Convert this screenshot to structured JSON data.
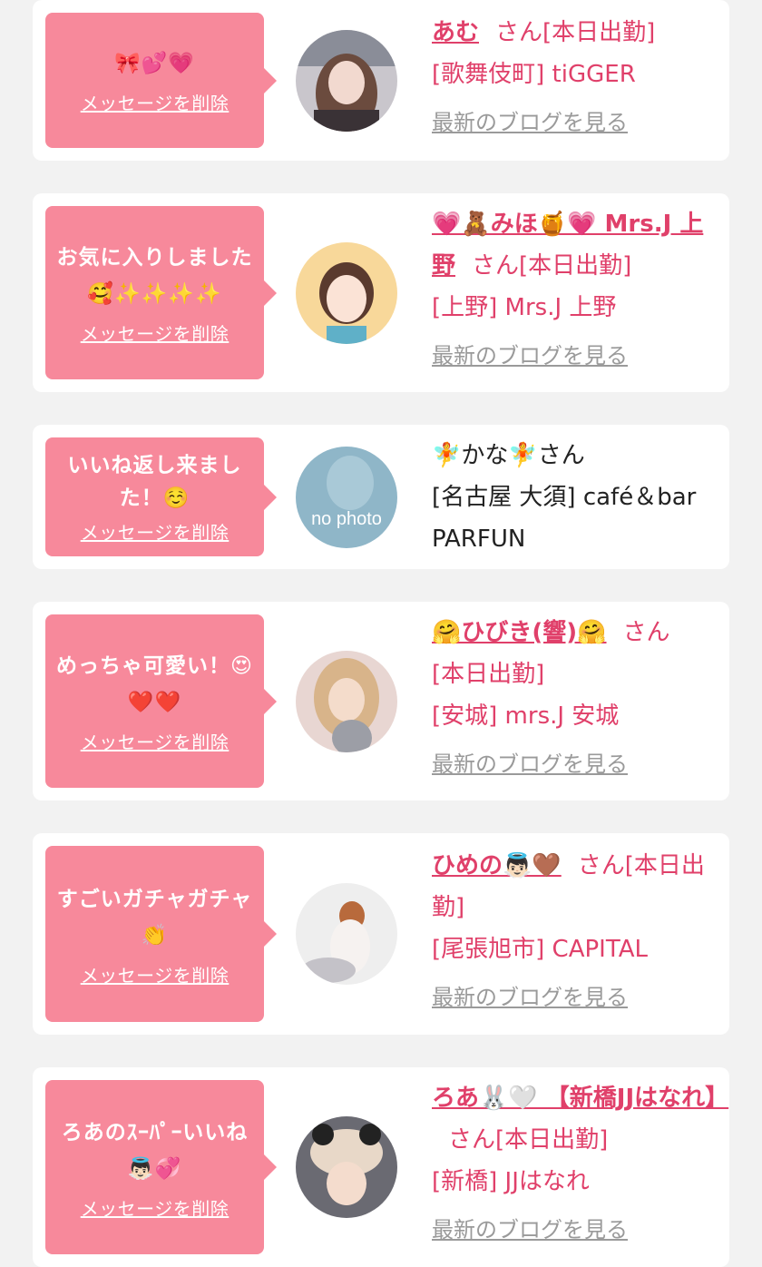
{
  "delete_label": "メッセージを削除",
  "blog_label": "最新のブログを見る",
  "colors": {
    "bubble": "#f7899b",
    "accent": "#e0406a",
    "muted": "#9a9a9a",
    "background": "#f2f2f2"
  },
  "items": [
    {
      "message": "🎀💕💗",
      "name": "あむ",
      "honorific": "さん",
      "status": "[本日出勤]",
      "shop": "[歌舞伎町] tiGGER",
      "has_blog": true,
      "avatar": "avatar-photo"
    },
    {
      "message": "お気に入りしました🥰✨✨✨✨",
      "name": "💗🧸みほ🍯💗 Mrs.J 上野",
      "honorific": "さん",
      "status": "[本日出勤]",
      "shop": "[上野] Mrs.J 上野",
      "has_blog": true,
      "avatar": "avatar-illustration"
    },
    {
      "message": "いいね返し来ました！☺️",
      "name": "🧚かな🧚",
      "honorific": "さん",
      "status": "",
      "shop": "[名古屋 大須] café＆bar PARFUN",
      "has_blog": false,
      "avatar": "no-photo",
      "avatar_text": "no photo"
    },
    {
      "message": "めっちゃ可愛い！😍❤️❤️",
      "name": "🤗ひびき(響)🤗",
      "honorific": "さん",
      "status": "[本日出勤]",
      "shop": "[安城] mrs.J 安城",
      "has_blog": true,
      "avatar": "avatar-photo"
    },
    {
      "message": "すごいガチャガチャ👏",
      "name": "ひめの👼🏻🤎",
      "honorific": "さん",
      "status": "[本日出勤]",
      "shop": "[尾張旭市] CAPITAL",
      "has_blog": true,
      "avatar": "avatar-photo"
    },
    {
      "message": "ろあのｽｰﾊﾟｰいいね👼🏻💞",
      "name": "ろあ🐰🤍 【新橋JJはなれ】",
      "honorific": "さん",
      "status": "[本日出勤]",
      "shop": "[新橋] JJはなれ",
      "has_blog": true,
      "avatar": "avatar-photo"
    }
  ]
}
